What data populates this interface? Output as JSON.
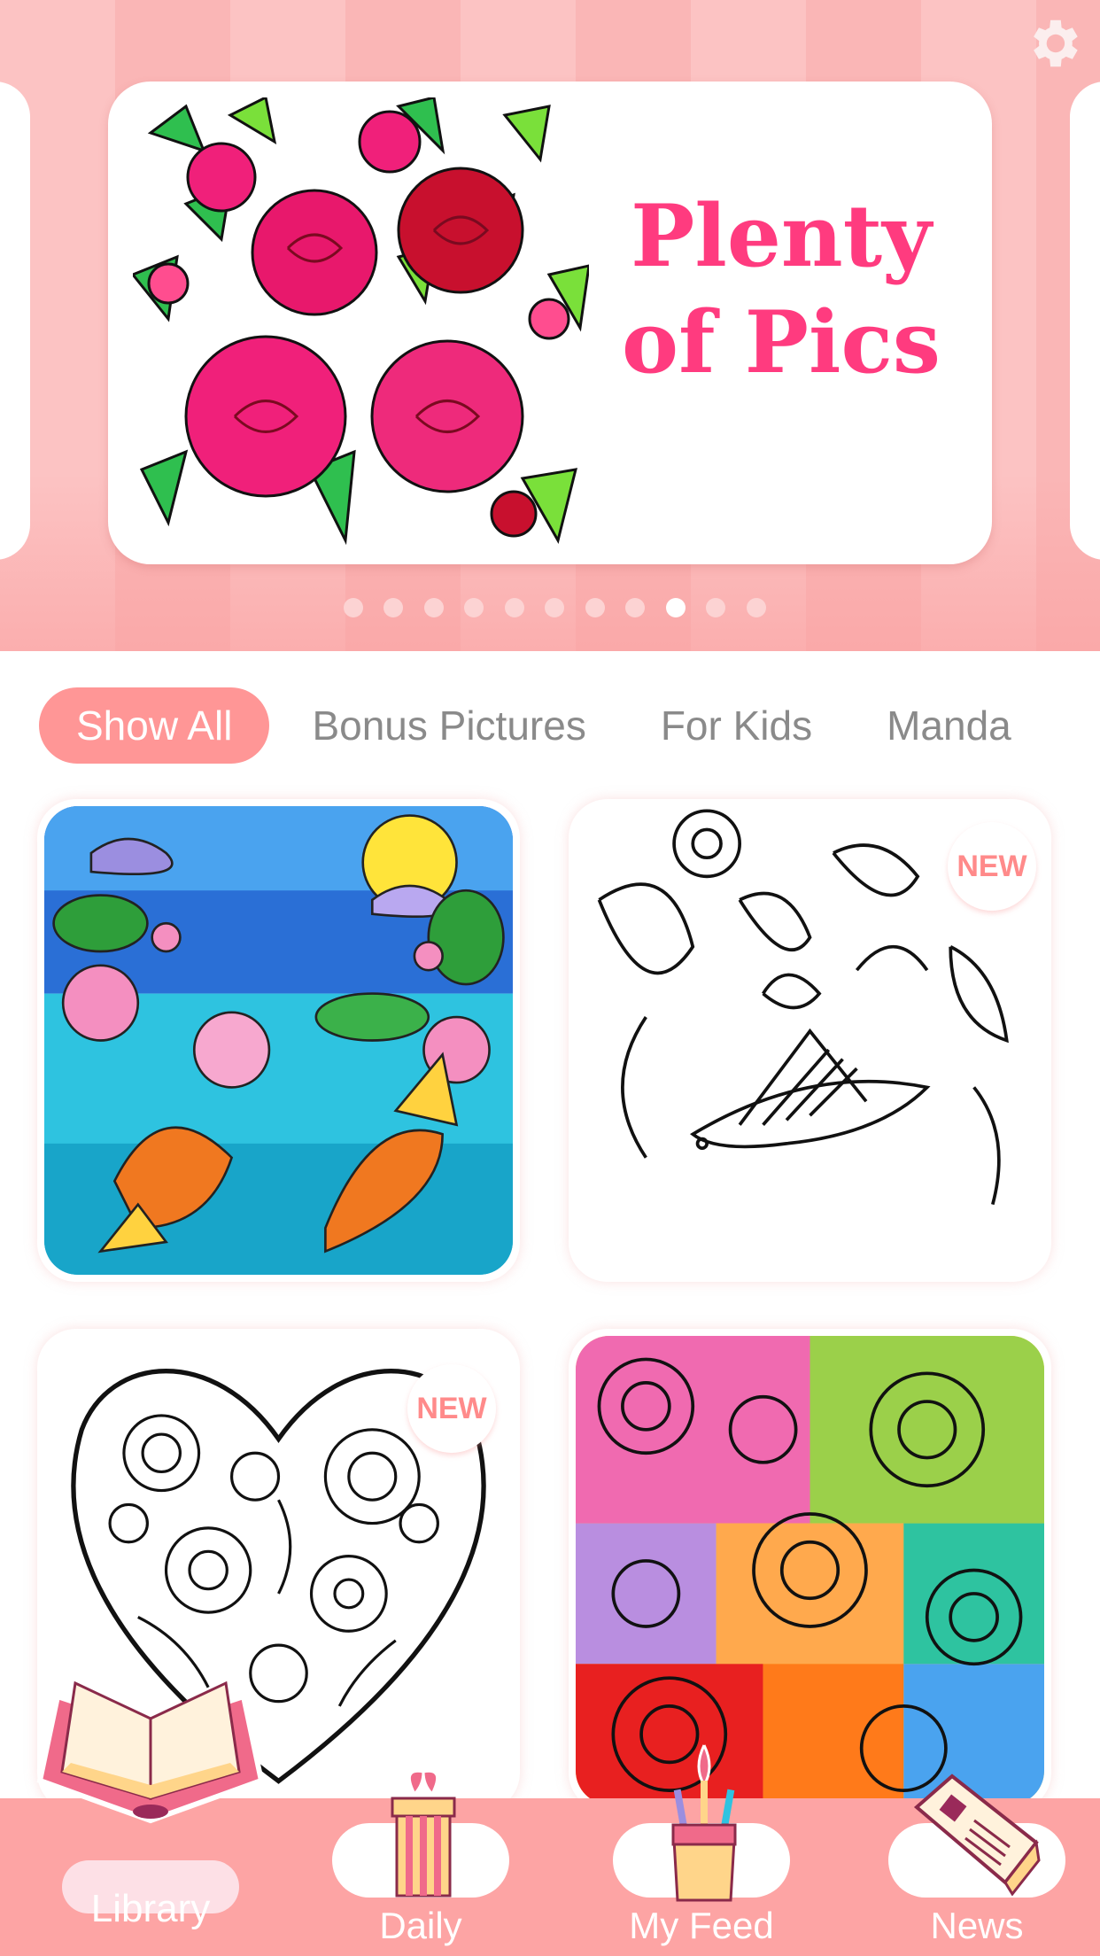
{
  "app": {
    "settings_icon": "gear-icon"
  },
  "banner": {
    "title_line1": "Plenty",
    "title_line2": "of Pics",
    "art": "roses-coloring-page",
    "pager": {
      "count": 11,
      "active_index": 8
    }
  },
  "categories": {
    "tabs": [
      {
        "label": "Show All",
        "active": true
      },
      {
        "label": "Bonus Pictures",
        "active": false
      },
      {
        "label": "For Kids",
        "active": false
      },
      {
        "label": "Manda",
        "active": false
      }
    ]
  },
  "gallery": {
    "tiles": [
      {
        "art": "koi-lotus-stained-glass",
        "badge": null
      },
      {
        "art": "bird-flowers-lineart",
        "badge": "NEW"
      },
      {
        "art": "mandala-heart-lineart",
        "badge": "NEW"
      },
      {
        "art": "rainbow-swirls",
        "badge": null
      }
    ]
  },
  "nav": {
    "items": [
      {
        "label": "Library",
        "icon": "book-icon",
        "active": true
      },
      {
        "label": "Daily",
        "icon": "gift-icon",
        "active": false
      },
      {
        "label": "My Feed",
        "icon": "brush-cup-icon",
        "active": false
      },
      {
        "label": "News",
        "icon": "newspaper-icon",
        "active": false
      }
    ]
  },
  "colors": {
    "accent": "#ff9696",
    "title_pink": "#ff3b7f",
    "nav_bg": "#fda4a4",
    "badge_text": "#ff8a8a"
  }
}
